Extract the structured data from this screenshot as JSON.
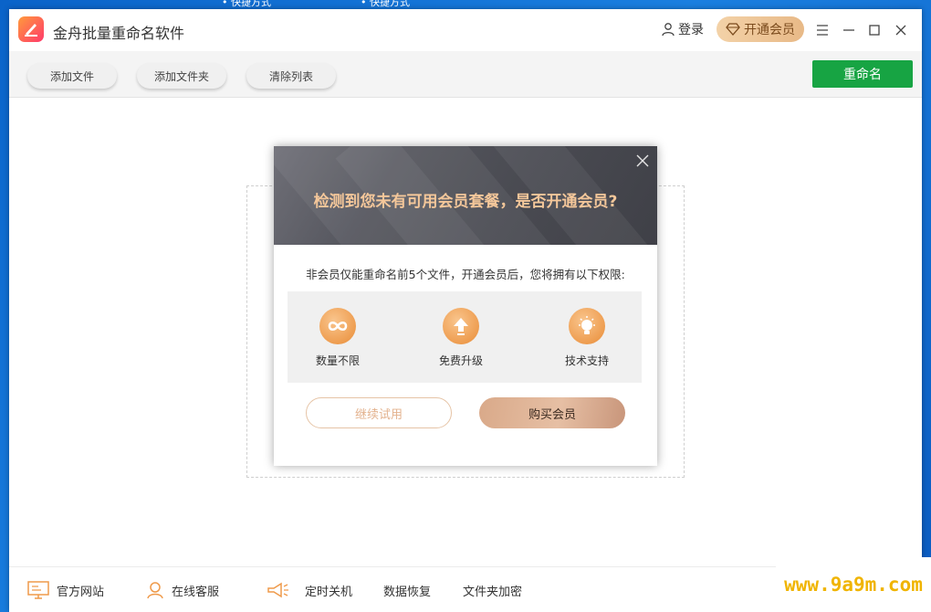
{
  "desktop": {
    "label_1": "• 快捷方式",
    "label_2": "• 快捷方式"
  },
  "app": {
    "title": "金舟批量重命名软件"
  },
  "header": {
    "login_label": "登录",
    "vip_label": "开通会员"
  },
  "toolbar": {
    "add_file": "添加文件",
    "add_folder": "添加文件夹",
    "clear_list": "清除列表",
    "rename": "重命名"
  },
  "modal": {
    "title": "检测到您未有可用会员套餐，是否开通会员?",
    "description": "非会员仅能重命名前5个文件，开通会员后，您将拥有以下权限:",
    "benefits": [
      {
        "label": "数量不限",
        "icon": "infinity-icon"
      },
      {
        "label": "免费升级",
        "icon": "upgrade-arrow-icon"
      },
      {
        "label": "技术支持",
        "icon": "lightbulb-icon"
      }
    ],
    "trial_label": "继续试用",
    "buy_label": "购买会员"
  },
  "footer": {
    "website": "官方网站",
    "support": "在线客服",
    "shutdown": "定时关机",
    "recovery": "数据恢复",
    "encrypt": "文件夹加密"
  },
  "watermark": "www.9a9m.com",
  "colors": {
    "rename_green": "#17a443",
    "vip_gold": "#e8b987",
    "icon_orange": "#ee9d50"
  }
}
